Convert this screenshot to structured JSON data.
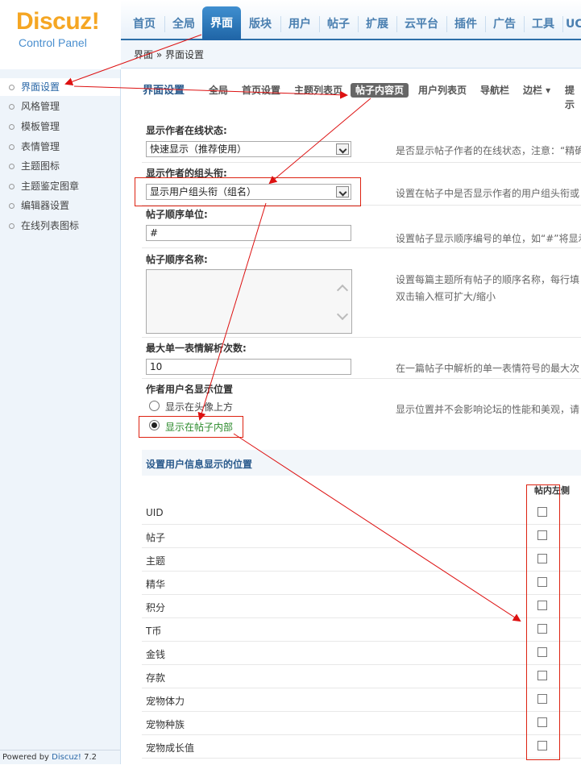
{
  "logo": {
    "brand": "Discuz!",
    "sub": "Control Panel"
  },
  "topnav": [
    "首页",
    "全局",
    "界面",
    "版块",
    "用户",
    "帖子",
    "扩展",
    "云平台",
    "插件",
    "广告",
    "工具",
    "UC"
  ],
  "breadcrumb": "界面 » 界面设置",
  "sidebar": {
    "items": [
      "界面设置",
      "风格管理",
      "模板管理",
      "表情管理",
      "主题图标",
      "主题鉴定图章",
      "编辑器设置",
      "在线列表图标"
    ],
    "footer_prefix": "Powered by",
    "footer_brand": "Discuz!",
    "footer_version": "7.2"
  },
  "subtabs": {
    "title": "界面设置",
    "items": [
      "全局",
      "首页设置",
      "主题列表页",
      "帖子内容页",
      "用户列表页",
      "导航栏",
      "边栏 ▾",
      "提示"
    ]
  },
  "form": {
    "online_status": {
      "label": "显示作者在线状态:",
      "value": "快速显示（推荐使用）",
      "hint": "是否显示帖子作者的在线状态，注意：“精确"
    },
    "group_title": {
      "label": "显示作者的组头衔:",
      "value": "显示用户组头衔（组名）",
      "hint": "设置在帖子中是否显示作者的用户组头衔或"
    },
    "order_unit": {
      "label": "帖子顺序单位:",
      "value": "#",
      "hint": "设置帖子显示顺序编号的单位，如“#”将显示"
    },
    "order_name": {
      "label": "帖子顺序名称:",
      "value": "",
      "hint1": "设置每篇主题所有帖子的顺序名称，每行填",
      "hint2": "双击输入框可扩大/缩小"
    },
    "smiley_max": {
      "label": "最大单一表情解析次数:",
      "value": "10",
      "hint": "在一篇帖子中解析的单一表情符号的最大次"
    },
    "name_position": {
      "label": "作者用户名显示位置",
      "opt1": "显示在头像上方",
      "opt2": "显示在帖子内部",
      "hint": "显示位置并不会影响论坛的性能和美观，请"
    }
  },
  "section": {
    "title": "设置用户信息显示的位置",
    "column": "帖内左侧"
  },
  "rows": [
    "UID",
    "帖子",
    "主题",
    "精华",
    "积分",
    "T币",
    "金钱",
    "存款",
    "宠物体力",
    "宠物种族",
    "宠物成长值"
  ]
}
